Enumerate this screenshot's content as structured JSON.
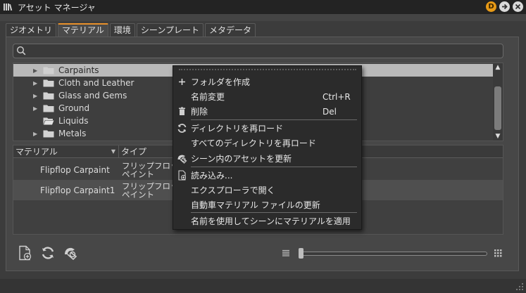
{
  "window": {
    "title": "アセット マネージャ",
    "badge": "D"
  },
  "tabs": [
    {
      "label": "ジオメトリ",
      "active": false
    },
    {
      "label": "マテリアル",
      "active": true
    },
    {
      "label": "環境",
      "active": false
    },
    {
      "label": "シーンプレート",
      "active": false
    },
    {
      "label": "メタデータ",
      "active": false
    }
  ],
  "search": {
    "placeholder": "",
    "value": ""
  },
  "tree": {
    "items": [
      {
        "label": "Carpaints",
        "selected": true
      },
      {
        "label": "Cloth and Leather",
        "selected": false
      },
      {
        "label": "Glass and Gems",
        "selected": false
      },
      {
        "label": "Ground",
        "selected": false
      },
      {
        "label": "Liquids",
        "selected": false
      },
      {
        "label": "Metals",
        "selected": false
      }
    ]
  },
  "grid": {
    "columns": [
      "マテリアル",
      "タイプ"
    ],
    "rows": [
      {
        "name": "Flipflop Carpaint",
        "type": "フリップフロップ\nペイント"
      },
      {
        "name": "Flipflop Carpaint1",
        "type": "フリップフロップ\nペイント"
      }
    ]
  },
  "context_menu": {
    "items": [
      {
        "label": "フォルダを作成",
        "shortcut": "",
        "icon": "plus-icon"
      },
      {
        "label": "名前変更",
        "shortcut": "Ctrl+R",
        "icon": ""
      },
      {
        "label": "削除",
        "shortcut": "Del",
        "icon": "trash-icon"
      },
      {
        "label": "ディレクトリを再ロード",
        "shortcut": "",
        "icon": "refresh-icon"
      },
      {
        "label": "すべてのディレクトリを再ロード",
        "shortcut": "",
        "icon": ""
      },
      {
        "label": "シーン内のアセットを更新",
        "shortcut": "",
        "icon": "update-scene-icon"
      },
      {
        "label": "読み込み...",
        "shortcut": "",
        "icon": "import-icon"
      },
      {
        "label": "エクスプローラで開く",
        "shortcut": "",
        "icon": ""
      },
      {
        "label": "自動車マテリアル ファイルの更新",
        "shortcut": "",
        "icon": ""
      },
      {
        "label": "名前を使用してシーンにマテリアルを適用",
        "shortcut": "",
        "icon": ""
      }
    ]
  },
  "colors": {
    "accent": "#e8902a",
    "selection": "#b9b9b9",
    "menu_bg": "#2b2b2b"
  }
}
